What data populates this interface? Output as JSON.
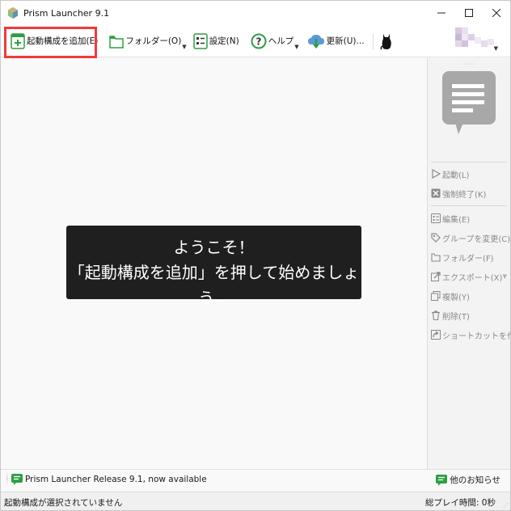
{
  "window": {
    "title": "Prism Launcher 9.1",
    "minimize_icon": "minimize-icon",
    "maximize_icon": "maximize-icon",
    "close_icon": "close-icon"
  },
  "toolbar": {
    "add_instance": "起動構成を追加(E)",
    "folders": "フォルダー(O)",
    "settings": "設定(N)",
    "help": "ヘルプ",
    "update": "更新(U)..."
  },
  "welcome": {
    "line1": "ようこそ！",
    "line2": "「起動構成を追加」を押して始めましょう。"
  },
  "instance_panel": {
    "launch": "起動(L)",
    "kill": "強制終了(K)",
    "edit": "編集(E)",
    "change_group": "グループを変更(C)",
    "folder": "フォルダー(F)",
    "export": "エクスポート(X)",
    "copy": "複製(Y)",
    "delete": "削除(T)",
    "shortcut": "ショートカットを作成"
  },
  "news": {
    "headline": "Prism Launcher Release 9.1, now available",
    "more": "他のお知らせ"
  },
  "status": {
    "left": "起動構成が選択されていません",
    "right": "総プレイ時間: 0秒"
  },
  "colors": {
    "accent_green": "#2e9e44",
    "highlight_red": "#f03a3a",
    "welcome_bg": "#1f1f1f"
  }
}
